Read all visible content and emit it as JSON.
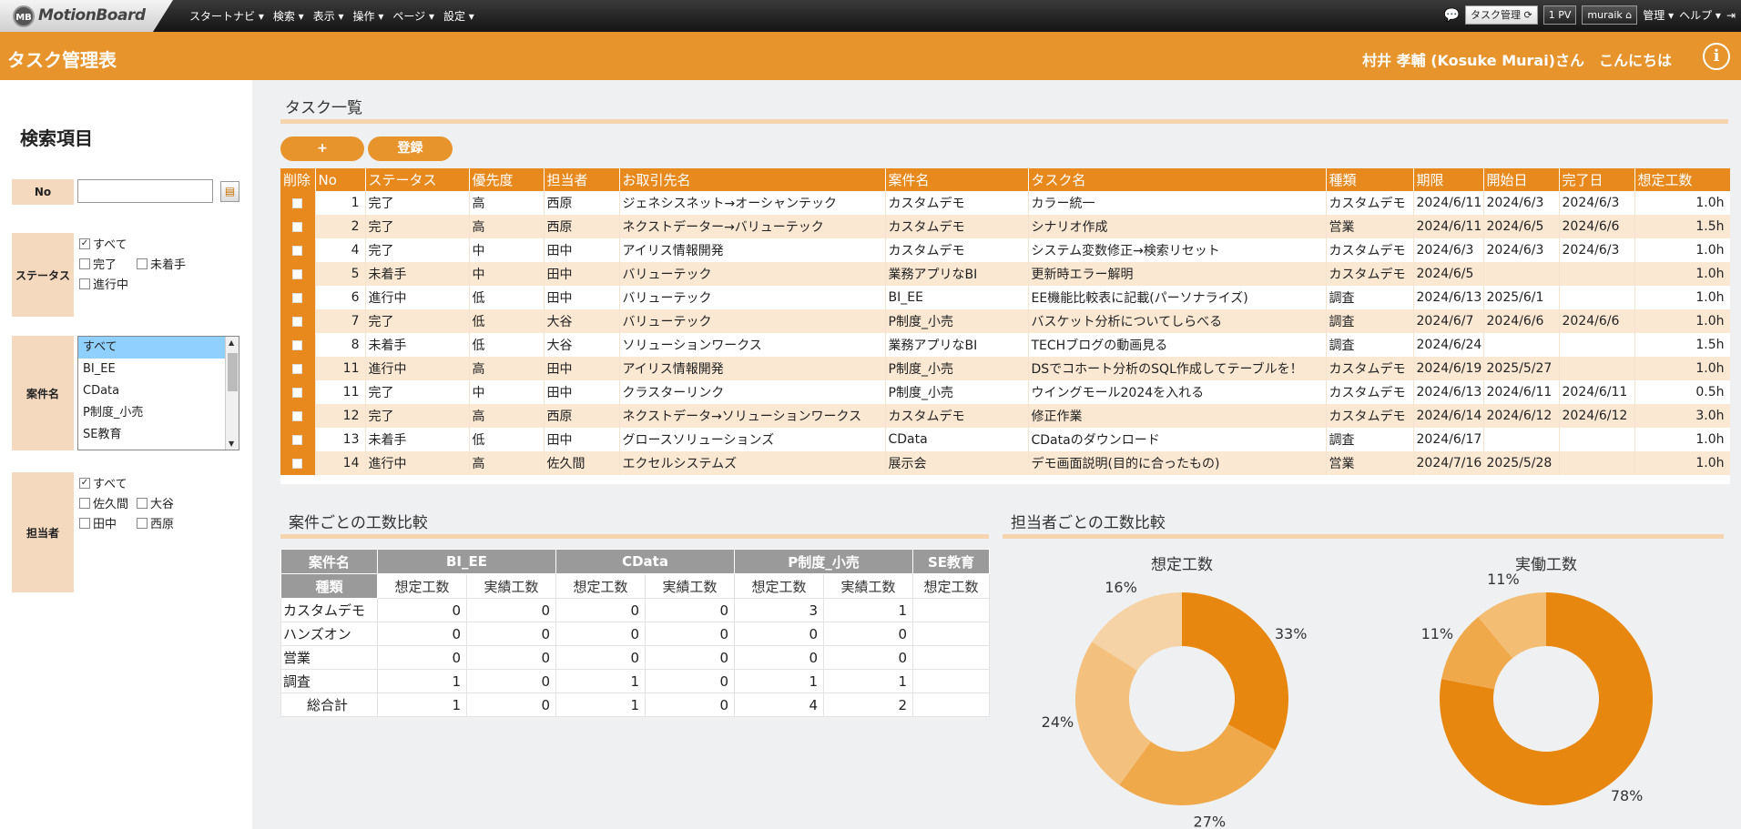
{
  "topbar": {
    "logo_badge": "MB",
    "logo": "MotionBoard",
    "menu": [
      "スタートナビ ▾",
      "検索 ▾",
      "表示 ▾",
      "操作 ▾",
      "ページ ▾",
      "設定 ▾"
    ],
    "task_btn": "タスク管理",
    "pv": "1 PV",
    "user_btn": "muraik",
    "admin": "管理 ▾",
    "help": "ヘルプ ▾"
  },
  "header": {
    "title": "タスク管理表",
    "user": "村井 孝輔 (Kosuke Murai)さん　こんにちは",
    "info": "i"
  },
  "sidebar": {
    "title": "検索項目",
    "no_label": "No",
    "status_label": "ステータス",
    "status_options": [
      "すべて",
      "完了",
      "未着手",
      "進行中"
    ],
    "project_label": "案件名",
    "project_options": [
      "すべて",
      "BI_EE",
      "CData",
      "P制度_小売",
      "SE教育"
    ],
    "person_label": "担当者",
    "person_options": [
      "すべて",
      "佐久間",
      "大谷",
      "田中",
      "西原"
    ]
  },
  "tasks": {
    "title": "タスク一覧",
    "add_btn": "+",
    "register_btn": "登録",
    "columns": [
      "削除",
      "No",
      "ステータス",
      "優先度",
      "担当者",
      "お取引先名",
      "案件名",
      "タスク名",
      "種類",
      "期限",
      "開始日",
      "完了日",
      "想定工数"
    ],
    "rows": [
      [
        "1",
        "完了",
        "高",
        "西原",
        "ジェネシスネット→オーシャンテック",
        "カスタムデモ",
        "カラー統一",
        "カスタムデモ",
        "2024/6/11",
        "2024/6/3",
        "2024/6/3",
        "1.0h"
      ],
      [
        "2",
        "完了",
        "高",
        "西原",
        "ネクストデーター→バリューテック",
        "カスタムデモ",
        "シナリオ作成",
        "営業",
        "2024/6/11",
        "2024/6/5",
        "2024/6/6",
        "1.5h"
      ],
      [
        "4",
        "完了",
        "中",
        "田中",
        "アイリス情報開発",
        "カスタムデモ",
        "システム変数修正→検索リセット",
        "カスタムデモ",
        "2024/6/3",
        "2024/6/3",
        "2024/6/3",
        "1.0h"
      ],
      [
        "5",
        "未着手",
        "中",
        "田中",
        "バリューテック",
        "業務アプリなBI",
        "更新時エラー解明",
        "カスタムデモ",
        "2024/6/5",
        "",
        "",
        "1.0h"
      ],
      [
        "6",
        "進行中",
        "低",
        "田中",
        "バリューテック",
        "BI_EE",
        "EE機能比較表に記載(パーソナライズ)",
        "調査",
        "2024/6/13",
        "2025/6/1",
        "",
        "1.0h"
      ],
      [
        "7",
        "完了",
        "低",
        "大谷",
        "バリューテック",
        "P制度_小売",
        "バスケット分析についてしらべる",
        "調査",
        "2024/6/7",
        "2024/6/6",
        "2024/6/6",
        "1.0h"
      ],
      [
        "8",
        "未着手",
        "低",
        "大谷",
        "ソリューションワークス",
        "業務アプリなBI",
        "TECHブログの動画見る",
        "調査",
        "2024/6/24",
        "",
        "",
        "1.5h"
      ],
      [
        "11",
        "進行中",
        "高",
        "田中",
        "アイリス情報開発",
        "P制度_小売",
        "DSでコホート分析のSQL作成してテーブルを！",
        "カスタムデモ",
        "2024/6/19",
        "2025/5/27",
        "",
        "1.0h"
      ],
      [
        "11",
        "完了",
        "中",
        "田中",
        "クラスターリンク",
        "P制度_小売",
        "ウイングモール2024を入れる",
        "カスタムデモ",
        "2024/6/13",
        "2024/6/11",
        "2024/6/11",
        "0.5h"
      ],
      [
        "12",
        "完了",
        "高",
        "西原",
        "ネクストデータ→ソリューションワークス",
        "カスタムデモ",
        "修正作業",
        "カスタムデモ",
        "2024/6/14",
        "2024/6/12",
        "2024/6/12",
        "3.0h"
      ],
      [
        "13",
        "未着手",
        "低",
        "田中",
        "グロースソリューションズ",
        "CData",
        "CDataのダウンロード",
        "調査",
        "2024/6/17",
        "",
        "",
        "1.0h"
      ],
      [
        "14",
        "進行中",
        "高",
        "佐久間",
        "エクセルシステムズ",
        "展示会",
        "デモ画面説明(目的に合ったもの)",
        "営業",
        "2024/7/16",
        "2025/5/28",
        "",
        "1.0h"
      ]
    ]
  },
  "comparison": {
    "title": "案件ごとの工数比較",
    "corner_project": "案件名",
    "corner_kind": "種類",
    "projects": [
      "BI_EE",
      "CData",
      "P制度_小売",
      "SE教育"
    ],
    "sub_headers": [
      "想定工数",
      "実績工数",
      "想定工数",
      "実績工数",
      "想定工数",
      "実績工数",
      "想定工数"
    ],
    "rows": [
      {
        "label": "カスタムデモ",
        "values": [
          "0",
          "0",
          "0",
          "0",
          "3",
          "1",
          ""
        ]
      },
      {
        "label": "ハンズオン",
        "values": [
          "0",
          "0",
          "0",
          "0",
          "0",
          "0",
          ""
        ]
      },
      {
        "label": "営業",
        "values": [
          "0",
          "0",
          "0",
          "0",
          "0",
          "0",
          ""
        ]
      },
      {
        "label": "調査",
        "values": [
          "1",
          "0",
          "1",
          "0",
          "1",
          "1",
          ""
        ]
      },
      {
        "label": "総合計",
        "values": [
          "1",
          "0",
          "1",
          "0",
          "4",
          "2",
          ""
        ]
      }
    ]
  },
  "person_compare": {
    "title": "担当者ごとの工数比較"
  },
  "chart_data": [
    {
      "type": "pie",
      "title": "想定工数",
      "donut": true,
      "slices": [
        {
          "value": 33,
          "label": "33%",
          "color": "#e8870f"
        },
        {
          "value": 27,
          "label": "27%",
          "color": "#f0a94a"
        },
        {
          "value": 24,
          "label": "24%",
          "color": "#f3c07d"
        },
        {
          "value": 16,
          "label": "16%",
          "color": "#f6d3a6"
        }
      ]
    },
    {
      "type": "pie",
      "title": "実働工数",
      "donut": true,
      "slices": [
        {
          "value": 78,
          "label": "78%",
          "color": "#e8870f"
        },
        {
          "value": 11,
          "label": "11%",
          "color": "#f0a94a"
        },
        {
          "value": 11,
          "label": "11%",
          "color": "#f3bd73"
        }
      ]
    }
  ]
}
